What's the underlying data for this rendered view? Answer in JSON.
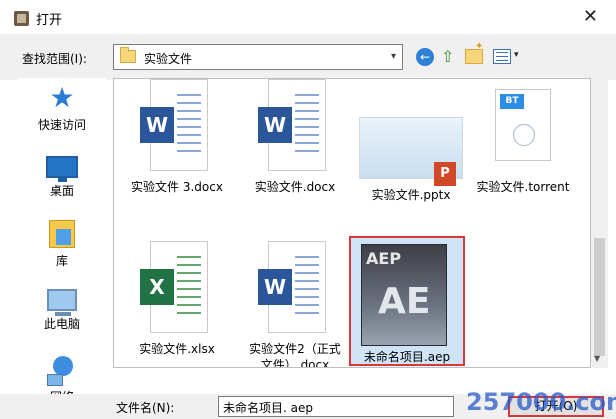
{
  "window": {
    "title": "打开",
    "close": "✕"
  },
  "toolbar": {
    "lookin_label": "查找范围(I):",
    "current_folder": "实验文件",
    "combo_arrow": "▾",
    "back_glyph": "←",
    "up_glyph": "⇧",
    "view_arrow": "▾"
  },
  "sidebar": {
    "items": [
      {
        "label": "快速访问",
        "icon": "quick-access-star-icon"
      },
      {
        "label": "桌面",
        "icon": "desktop-icon"
      },
      {
        "label": "库",
        "icon": "library-icon"
      },
      {
        "label": "此电脑",
        "icon": "this-pc-icon"
      },
      {
        "label": "网络",
        "icon": "network-icon"
      }
    ]
  },
  "files": [
    {
      "label": "实验文件 3.docx",
      "type": "word",
      "badge": "W"
    },
    {
      "label": "实验文件.docx",
      "type": "word",
      "badge": "W"
    },
    {
      "label": "实验文件.pptx",
      "type": "powerpoint",
      "badge": "P"
    },
    {
      "label": "实验文件.torrent",
      "type": "torrent",
      "badge": "BT"
    },
    {
      "label": "实验文件.xlsx",
      "type": "excel",
      "badge": "X"
    },
    {
      "label": "实验文件2（正式文件）.docx",
      "type": "word",
      "badge": "W"
    },
    {
      "label": "未命名项目.aep",
      "type": "aftereffects",
      "badge_top": "AEP",
      "badge_main": "AE",
      "selected": true
    }
  ],
  "bottom": {
    "filename_label": "文件名(N):",
    "filename_value": "未命名项目. aep",
    "open_label": "打开(O)"
  },
  "watermark": "257000.com",
  "colors": {
    "selection_border": "#d9373a",
    "selection_fill": "#cfe4f7",
    "word": "#2b579a",
    "excel": "#217346",
    "ppt": "#d24726"
  }
}
